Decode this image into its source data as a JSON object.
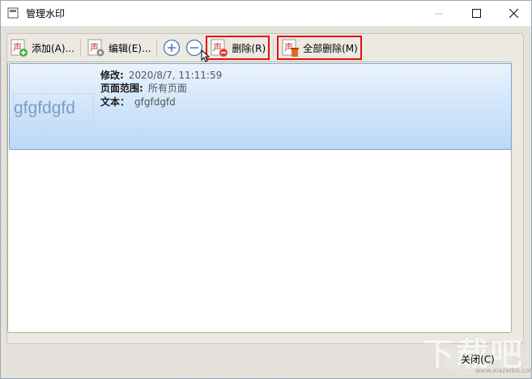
{
  "window": {
    "title": "管理水印"
  },
  "toolbar": {
    "add_label": "添加(A)...",
    "edit_label": "编辑(E)...",
    "delete_label": "删除(R)",
    "delete_all_label": "全部删除(M)"
  },
  "watermark_item": {
    "preview_text": "gfgfdgfd",
    "modified_key": "修改:",
    "modified_value": "2020/8/7, 11:11:59",
    "page_range_key": "页面范围:",
    "page_range_value": "所有页面",
    "text_key": "文本：",
    "text_value": "gfgfdgfd"
  },
  "footer": {
    "close_label": "关闭(C)"
  },
  "site_watermark": {
    "text": "下载吧",
    "url": "www.xiazaiba.com"
  },
  "colors": {
    "highlight_red": "#e01010",
    "selection_blue": "#bcd8f7",
    "panel_bg": "#ece9e3"
  }
}
